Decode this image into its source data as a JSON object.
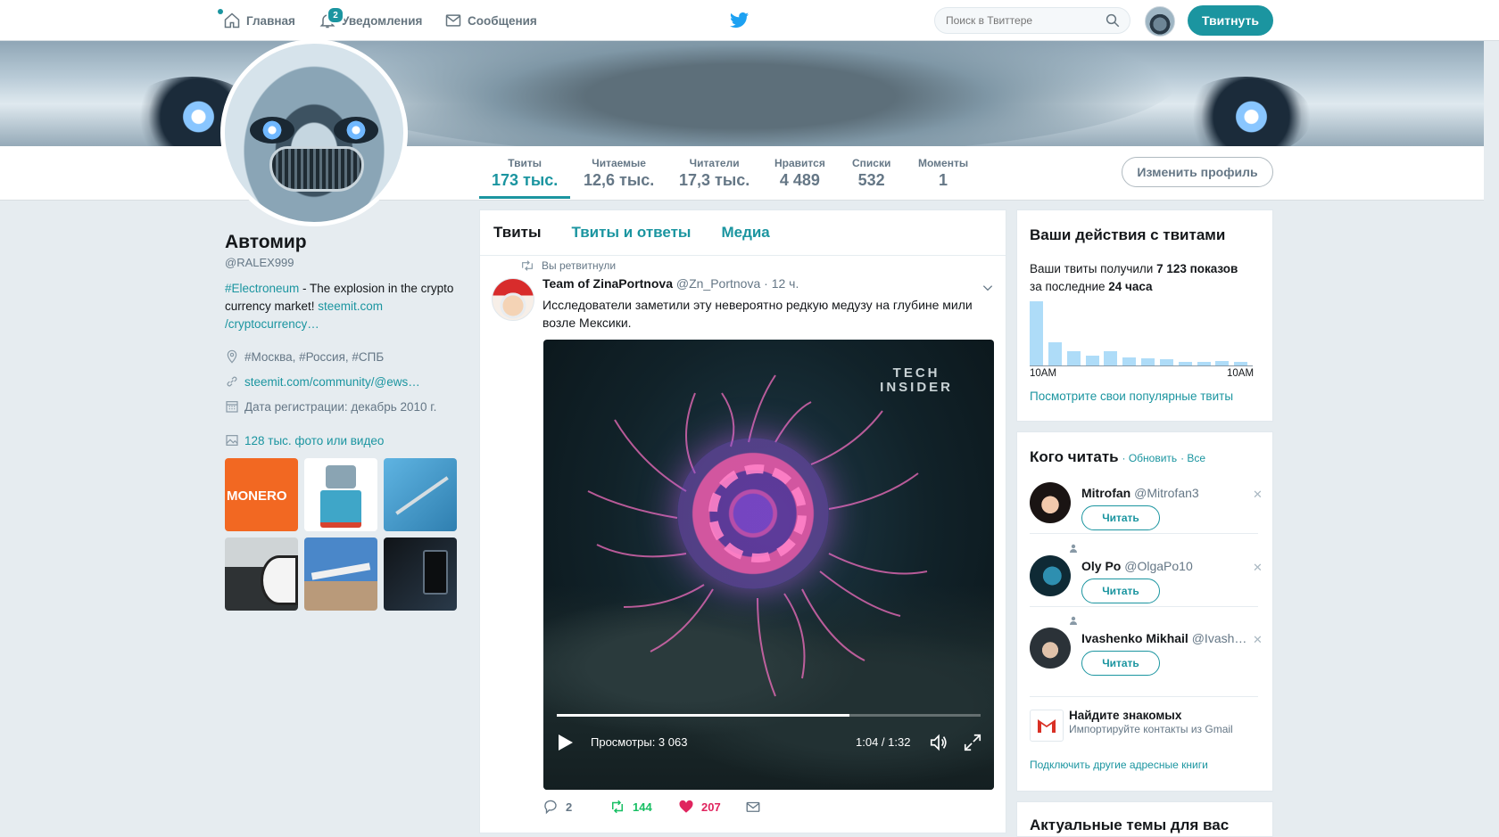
{
  "topbar": {
    "home": "Главная",
    "notifications": "Уведомления",
    "notifications_count": "2",
    "messages": "Сообщения",
    "search_placeholder": "Поиск в Твиттере",
    "tweet_button": "Твитнуть"
  },
  "stats": [
    {
      "label": "Твиты",
      "value": "173 тыс."
    },
    {
      "label": "Читаемые",
      "value": "12,6 тыс."
    },
    {
      "label": "Читатели",
      "value": "17,3 тыс."
    },
    {
      "label": "Нравится",
      "value": "4 489"
    },
    {
      "label": "Списки",
      "value": "532"
    },
    {
      "label": "Моменты",
      "value": "1"
    }
  ],
  "edit_profile": "Изменить профиль",
  "profile": {
    "name": "Автомир",
    "handle": "@RALEX999",
    "bio_hashtag": "#Electroneum",
    "bio_text": " - The explosion in the crypto currency market! ",
    "bio_link": "steemit.com /cryptocurrency…",
    "location": "#Москва, #Россия, #СПБ",
    "website": "steemit.com/community/@ews…",
    "joined": "Дата регистрации: декабрь 2010 г.",
    "media_link": "128 тыс. фото или видео",
    "thumb_monero": "MONERO"
  },
  "timeline": {
    "tabs": [
      "Твиты",
      "Твиты и ответы",
      "Медиа"
    ],
    "retweeted_label": "Вы ретвитнули",
    "tweet": {
      "author": "Team of ZinaPortnova",
      "handle": "@Zn_Portnova",
      "time": "· 12 ч.",
      "text": "Исследователи заметили эту невероятно редкую медузу на глубине мили возле Мексики.",
      "video_logo_1": "TECH",
      "video_logo_2": "INSIDER",
      "views": "Просмотры: 3 063",
      "time_display": "1:04 / 1:32",
      "progress": 0.69,
      "replies": "2",
      "retweets": "144",
      "likes": "207"
    }
  },
  "activity": {
    "title": "Ваши действия с твитами",
    "line_pre": "Ваши твиты получили ",
    "impressions": "7 123 показов",
    "line2_pre": "за последние ",
    "period": "24 часа",
    "axis_start": "10AM",
    "axis_end": "10AM",
    "bar_values": [
      100,
      36,
      22,
      15,
      22,
      12,
      11,
      10,
      6,
      5,
      7,
      6
    ],
    "link": "Посмотрите свои популярные твиты"
  },
  "who_to_follow": {
    "title": "Кого читать",
    "refresh": "· Обновить",
    "all": "· Все",
    "follow_label": "Читать",
    "users": [
      {
        "name": "Mitrofan",
        "handle": "@Mitrofan3"
      },
      {
        "name": "Oly Po",
        "handle": "@OlgaPo10"
      },
      {
        "name": "Ivashenko Mikhail",
        "handle": "@Ivash…"
      }
    ],
    "find_friends": "Найдите знакомых",
    "import_contacts": "Импортируйте контакты из Gmail",
    "other_books": "Подключить другие адресные книги"
  },
  "trends": {
    "title": "Актуальные темы для вас"
  },
  "colors": {
    "accent": "#1b95a0",
    "like": "#e0245e",
    "retweet": "#17bf63"
  }
}
